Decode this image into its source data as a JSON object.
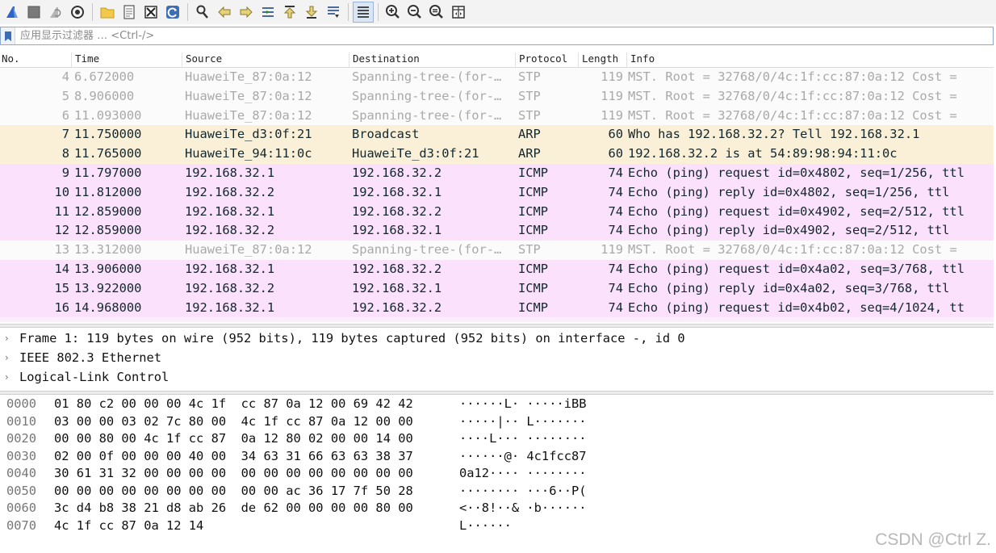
{
  "toolbar": {
    "buttons": [
      {
        "icon": "shark-fin-start-icon"
      },
      {
        "icon": "stop-square-icon"
      },
      {
        "icon": "restart-fin-icon"
      },
      {
        "icon": "capture-options-gear-icon"
      },
      {
        "icon": "open-folder-icon"
      },
      {
        "icon": "save-file-icon"
      },
      {
        "icon": "close-file-icon"
      },
      {
        "icon": "reload-icon"
      },
      {
        "icon": "find-packet-icon"
      },
      {
        "icon": "go-back-icon"
      },
      {
        "icon": "go-forward-icon"
      },
      {
        "icon": "go-to-packet-icon"
      },
      {
        "icon": "go-first-icon"
      },
      {
        "icon": "go-last-icon"
      },
      {
        "icon": "auto-scroll-icon"
      },
      {
        "icon": "colorize-icon"
      },
      {
        "icon": "zoom-in-icon"
      },
      {
        "icon": "zoom-out-icon"
      },
      {
        "icon": "normal-size-icon"
      },
      {
        "icon": "resize-columns-icon"
      }
    ]
  },
  "filter": {
    "placeholder": "应用显示过滤器 … <Ctrl-/>"
  },
  "packet_list": {
    "columns": [
      "No.",
      "Time",
      "Source",
      "Destination",
      "Protocol",
      "Length",
      "Info"
    ],
    "rows": [
      {
        "no": "4",
        "time": "6.672000",
        "src": "HuaweiTe_87:0a:12",
        "dst": "Spanning-tree-(for-…",
        "proto": "STP",
        "len": "119",
        "info": "MST. Root = 32768/0/4c:1f:cc:87:0a:12  Cost =",
        "kind": "stp"
      },
      {
        "no": "5",
        "time": "8.906000",
        "src": "HuaweiTe_87:0a:12",
        "dst": "Spanning-tree-(for-…",
        "proto": "STP",
        "len": "119",
        "info": "MST. Root = 32768/0/4c:1f:cc:87:0a:12  Cost =",
        "kind": "stp"
      },
      {
        "no": "6",
        "time": "11.093000",
        "src": "HuaweiTe_87:0a:12",
        "dst": "Spanning-tree-(for-…",
        "proto": "STP",
        "len": "119",
        "info": "MST. Root = 32768/0/4c:1f:cc:87:0a:12  Cost =",
        "kind": "stp"
      },
      {
        "no": "7",
        "time": "11.750000",
        "src": "HuaweiTe_d3:0f:21",
        "dst": "Broadcast",
        "proto": "ARP",
        "len": "60",
        "info": "Who has 192.168.32.2? Tell 192.168.32.1",
        "kind": "arp"
      },
      {
        "no": "8",
        "time": "11.765000",
        "src": "HuaweiTe_94:11:0c",
        "dst": "HuaweiTe_d3:0f:21",
        "proto": "ARP",
        "len": "60",
        "info": "192.168.32.2 is at 54:89:98:94:11:0c",
        "kind": "arp"
      },
      {
        "no": "9",
        "time": "11.797000",
        "src": "192.168.32.1",
        "dst": "192.168.32.2",
        "proto": "ICMP",
        "len": "74",
        "info": "Echo (ping) request  id=0x4802, seq=1/256, ttl",
        "kind": "icmp"
      },
      {
        "no": "10",
        "time": "11.812000",
        "src": "192.168.32.2",
        "dst": "192.168.32.1",
        "proto": "ICMP",
        "len": "74",
        "info": "Echo (ping) reply    id=0x4802, seq=1/256, ttl",
        "kind": "icmp"
      },
      {
        "no": "11",
        "time": "12.859000",
        "src": "192.168.32.1",
        "dst": "192.168.32.2",
        "proto": "ICMP",
        "len": "74",
        "info": "Echo (ping) request  id=0x4902, seq=2/512, ttl",
        "kind": "icmp"
      },
      {
        "no": "12",
        "time": "12.859000",
        "src": "192.168.32.2",
        "dst": "192.168.32.1",
        "proto": "ICMP",
        "len": "74",
        "info": "Echo (ping) reply    id=0x4902, seq=2/512, ttl",
        "kind": "icmp"
      },
      {
        "no": "13",
        "time": "13.312000",
        "src": "HuaweiTe_87:0a:12",
        "dst": "Spanning-tree-(for-…",
        "proto": "STP",
        "len": "119",
        "info": "MST. Root = 32768/0/4c:1f:cc:87:0a:12  Cost =",
        "kind": "stp"
      },
      {
        "no": "14",
        "time": "13.906000",
        "src": "192.168.32.1",
        "dst": "192.168.32.2",
        "proto": "ICMP",
        "len": "74",
        "info": "Echo (ping) request  id=0x4a02, seq=3/768, ttl",
        "kind": "icmp"
      },
      {
        "no": "15",
        "time": "13.922000",
        "src": "192.168.32.2",
        "dst": "192.168.32.1",
        "proto": "ICMP",
        "len": "74",
        "info": "Echo (ping) reply    id=0x4a02, seq=3/768, ttl",
        "kind": "icmp"
      },
      {
        "no": "16",
        "time": "14.968000",
        "src": "192.168.32.1",
        "dst": "192.168.32.2",
        "proto": "ICMP",
        "len": "74",
        "info": "Echo (ping) request  id=0x4b02, seq=4/1024, tt",
        "kind": "icmp"
      }
    ]
  },
  "details": {
    "items": [
      "Frame 1: 119 bytes on wire (952 bits), 119 bytes captured (952 bits) on interface -, id 0",
      "IEEE 802.3 Ethernet",
      "Logical-Link Control"
    ]
  },
  "hex": {
    "rows": [
      {
        "offset": "0000",
        "bytes": "01 80 c2 00 00 00 4c 1f  cc 87 0a 12 00 69 42 42",
        "ascii": "······L· ·····iBB"
      },
      {
        "offset": "0010",
        "bytes": "03 00 00 03 02 7c 80 00  4c 1f cc 87 0a 12 00 00",
        "ascii": "·····|·· L·······"
      },
      {
        "offset": "0020",
        "bytes": "00 00 80 00 4c 1f cc 87  0a 12 80 02 00 00 14 00",
        "ascii": "····L··· ········"
      },
      {
        "offset": "0030",
        "bytes": "02 00 0f 00 00 00 40 00  34 63 31 66 63 63 38 37",
        "ascii": "······@· 4c1fcc87"
      },
      {
        "offset": "0040",
        "bytes": "30 61 31 32 00 00 00 00  00 00 00 00 00 00 00 00",
        "ascii": "0a12···· ········"
      },
      {
        "offset": "0050",
        "bytes": "00 00 00 00 00 00 00 00  00 00 ac 36 17 7f 50 28",
        "ascii": "········ ···6··P("
      },
      {
        "offset": "0060",
        "bytes": "3c d4 b8 38 21 d8 ab 26  de 62 00 00 00 00 80 00",
        "ascii": "<··8!··& ·b······"
      },
      {
        "offset": "0070",
        "bytes": "4c 1f cc 87 0a 12 14",
        "ascii": "L······"
      }
    ]
  },
  "watermark": "CSDN @Ctrl Z."
}
